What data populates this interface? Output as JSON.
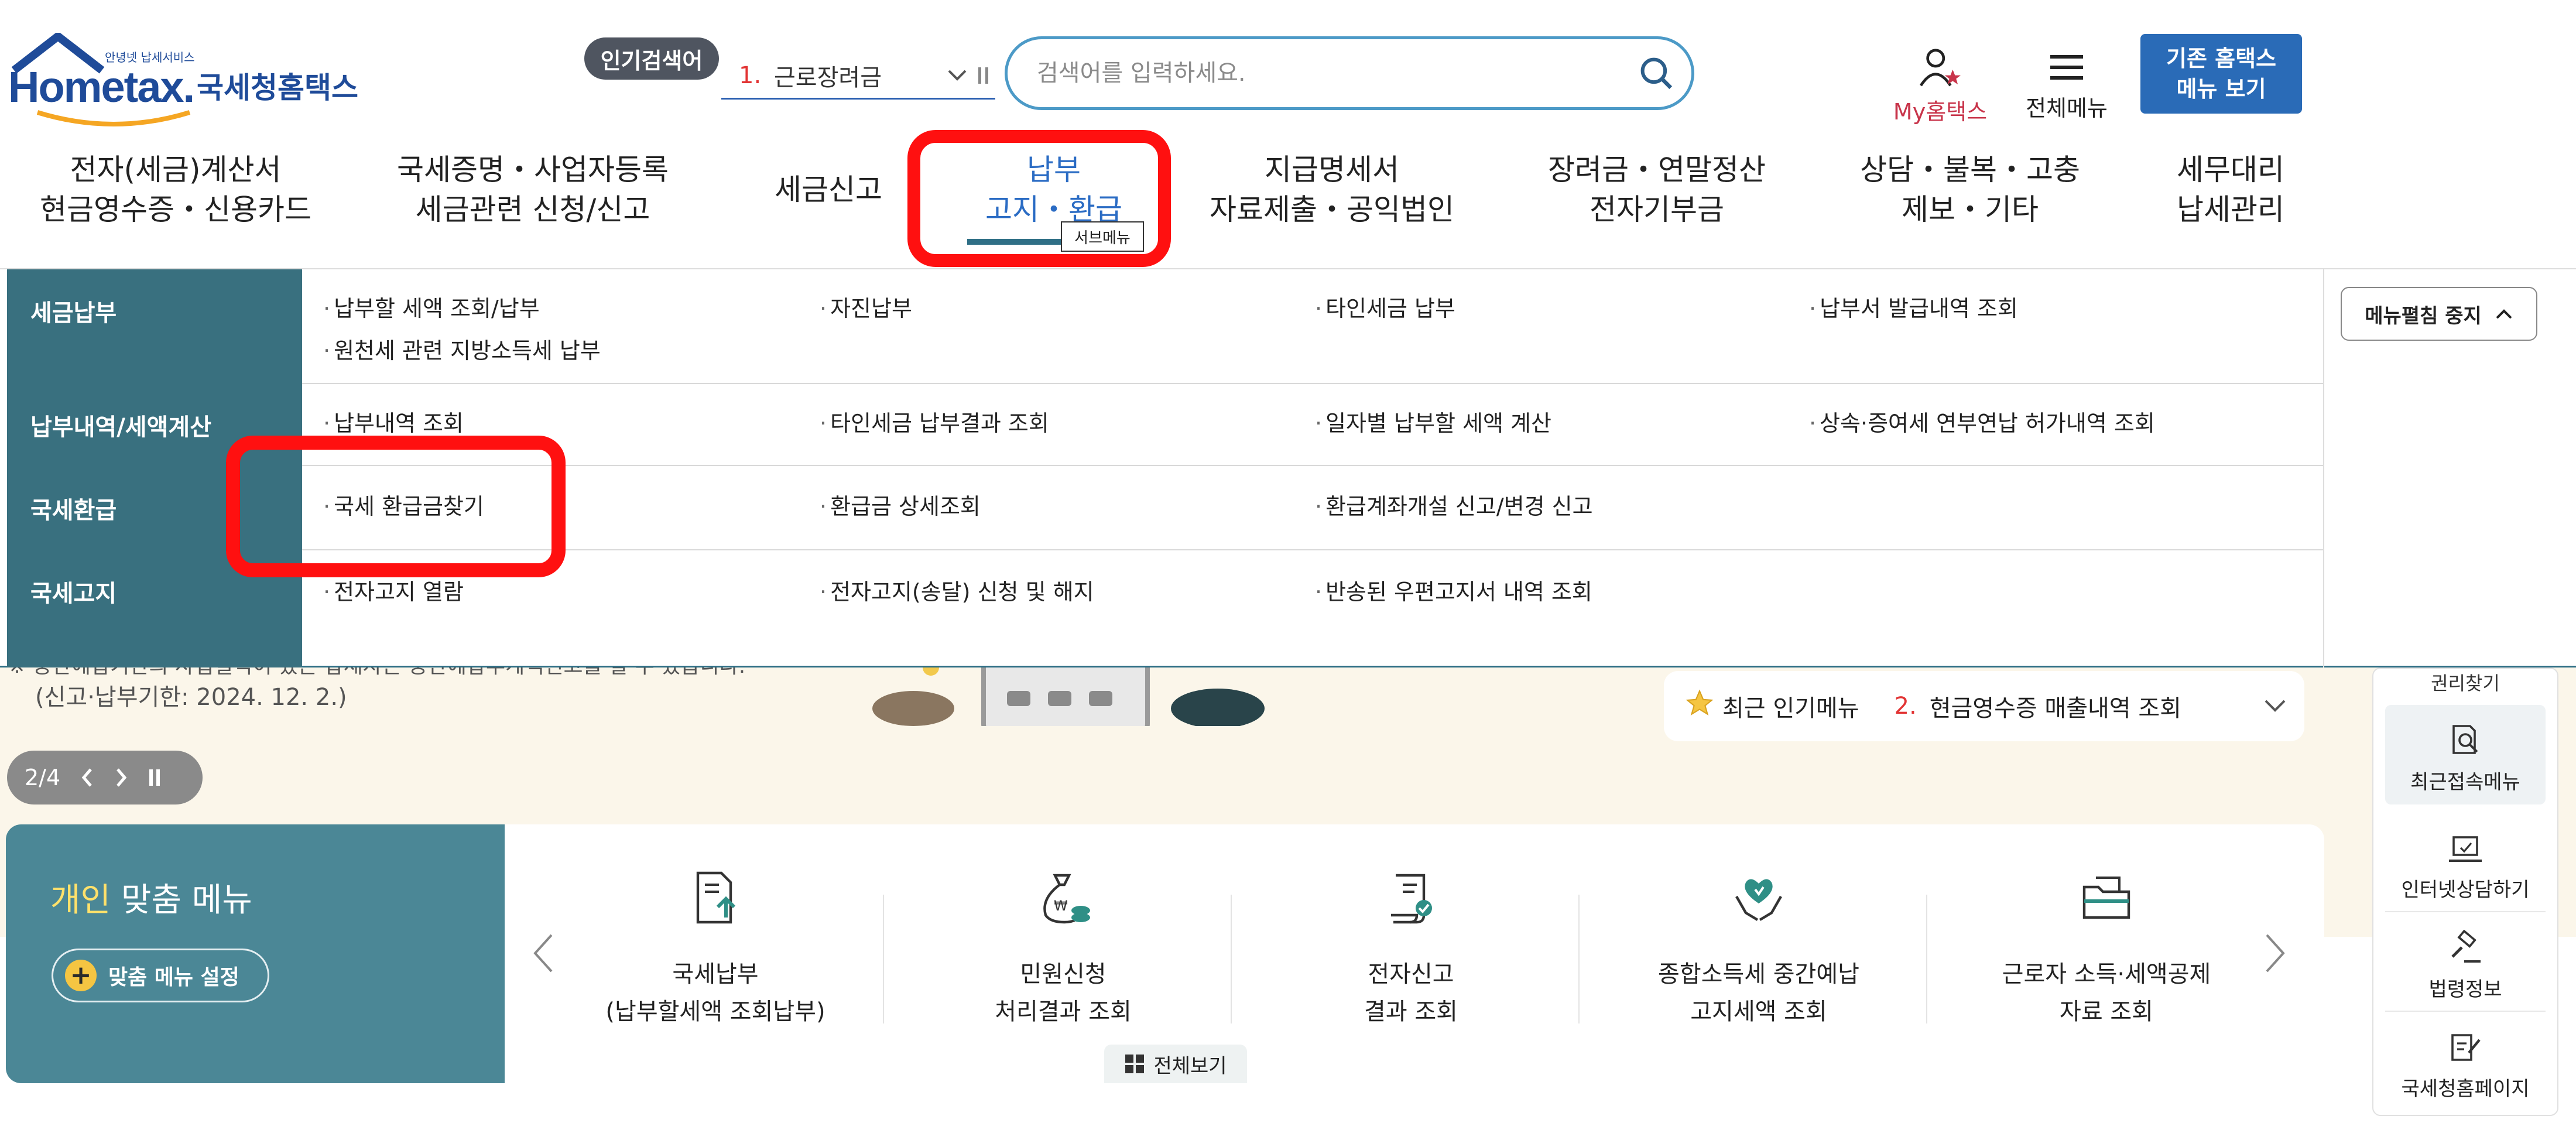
{
  "header": {
    "logo_tagline": "안녕넷 납세서비스",
    "logo_text": "Hometax.",
    "logo_korean": "국세청홈택스",
    "popular_badge": "인기검색어",
    "popular_rank": "1.",
    "popular_term": "근로장려금",
    "search_placeholder": "검색어를 입력하세요.",
    "my_hometax": "My홈택스",
    "all_menu": "전체메뉴",
    "legacy_line1": "기존 홈택스",
    "legacy_line2": "메뉴 보기"
  },
  "gnb": {
    "items": [
      {
        "line1": "전자(세금)계산서",
        "line2": "현금영수증・신용카드"
      },
      {
        "line1": "국세증명・사업자등록",
        "line2": "세금관련 신청/신고"
      },
      {
        "line1": "세금신고",
        "line2": ""
      },
      {
        "line1": "납부",
        "line2": "고지・환급"
      },
      {
        "line1": "지급명세서",
        "line2": "자료제출・공익법인"
      },
      {
        "line1": "장려금・연말정산",
        "line2": "전자기부금"
      },
      {
        "line1": "상담・불복・고충",
        "line2": "제보・기타"
      },
      {
        "line1": "세무대리",
        "line2": "납세관리"
      }
    ],
    "submenu_tag": "서브메뉴"
  },
  "mega": {
    "categories": [
      "세금납부",
      "납부내역/세액계산",
      "국세환급",
      "국세고지"
    ],
    "rows": [
      [
        "납부할 세액 조회/납부",
        "자진납부",
        "타인세금 납부",
        "납부서 발급내역 조회",
        "원천세 관련 지방소득세 납부"
      ],
      [
        "납부내역 조회",
        "타인세금 납부결과 조회",
        "일자별 납부할 세액 계산",
        "상속·증여세 연부연납 허가내역 조회"
      ],
      [
        "국세 환급금찾기",
        "환급금 상세조회",
        "환급계좌개설 신고/변경 신고"
      ],
      [
        "전자고지 열람",
        "전자고지(송달) 신청 및 해지",
        "반송된 우편고지서 내역 조회"
      ]
    ],
    "stop_label": "메뉴펼침 중지"
  },
  "banner": {
    "text1": "※ 중간예납기간의 사업실적이 있는 납세자는 중간예납추계액신고를 할 수 있습니다.",
    "text2": "(신고·납부기한: 2024. 12. 2.)",
    "pager": "2/4"
  },
  "popular_menu": {
    "label": "최근 인기메뉴",
    "rank": "2.",
    "item": "현금영수증 매출내역 조회"
  },
  "personal": {
    "title_accent": "개인",
    "title_rest": " 맞춤 메뉴",
    "setting": "맞춤 메뉴 설정",
    "items": [
      {
        "line1": "국세납부",
        "line2": "(납부할세액 조회납부)"
      },
      {
        "line1": "민원신청",
        "line2": "처리결과 조회"
      },
      {
        "line1": "전자신고",
        "line2": "결과 조회"
      },
      {
        "line1": "종합소득세 중간예납",
        "line2": "고지세액 조회"
      },
      {
        "line1": "근로자 소득·세액공제",
        "line2": "자료 조회"
      }
    ],
    "view_all": "전체보기"
  },
  "quick": {
    "top": "권리찾기",
    "items": [
      "최근접속메뉴",
      "인터넷상담하기",
      "법령정보",
      "국세청홈페이지"
    ]
  }
}
